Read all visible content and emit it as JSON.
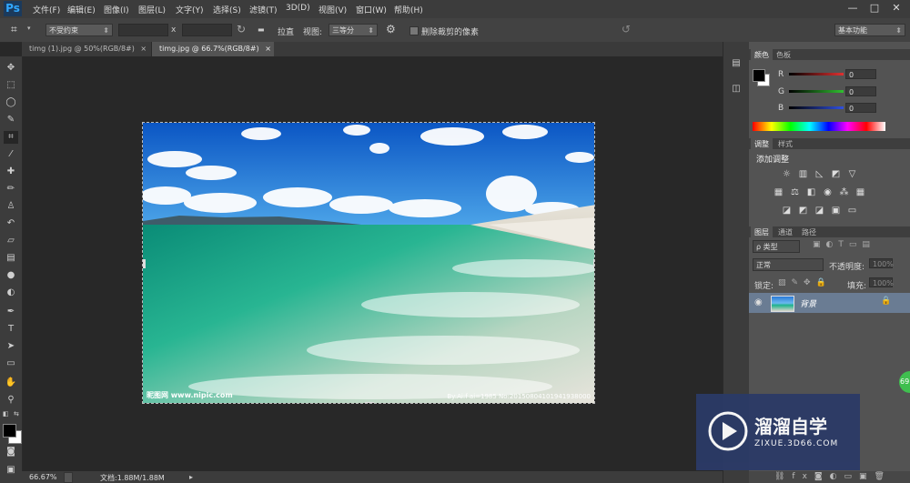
{
  "app": {
    "logo": "Ps"
  },
  "menu": [
    "文件(F)",
    "编辑(E)",
    "图像(I)",
    "图层(L)",
    "文字(Y)",
    "选择(S)",
    "滤镜(T)",
    "3D(D)",
    "视图(V)",
    "窗口(W)",
    "帮助(H)"
  ],
  "window_controls": [
    "—",
    "□",
    "✕"
  ],
  "options": {
    "constraint": "不受约束",
    "multiply": "x",
    "straighten": "拉直",
    "view_label": "视图:",
    "view_value": "三等分",
    "delete_cropped": "删除裁剪的像素",
    "workspace": "基本功能"
  },
  "tabs": [
    {
      "label": "timg (1).jpg @ 50%(RGB/8#)",
      "close": "×"
    },
    {
      "label": "timg.jpg @ 66.7%(RGB/8#)",
      "close": "×"
    }
  ],
  "canvas": {
    "watermark_left": "昵图网 www.nipic.com",
    "watermark_right": "By:Ai:f ai=1985 No:20150804101941938000"
  },
  "status": {
    "zoom": "66.67%",
    "doc": "文档:1.88M/1.88M"
  },
  "color_panel": {
    "tabs": [
      "颜色",
      "色板"
    ],
    "channels": [
      {
        "label": "R",
        "value": "0",
        "color": "#e03030"
      },
      {
        "label": "G",
        "value": "0",
        "color": "#30c030"
      },
      {
        "label": "B",
        "value": "0",
        "color": "#3050e0"
      }
    ]
  },
  "adjust_panel": {
    "tabs": [
      "调整",
      "样式"
    ],
    "title": "添加调整"
  },
  "layers_panel": {
    "tabs": [
      "图层",
      "通道",
      "路径"
    ],
    "filter": "ρ 类型",
    "blend_mode": "正常",
    "opacity_label": "不透明度:",
    "opacity_value": "100%",
    "lock_label": "锁定:",
    "fill_label": "填充:",
    "fill_value": "100%",
    "layer_name": "背景"
  },
  "badge": {
    "value": "69"
  },
  "brand": {
    "title": "溜溜自学",
    "subtitle": "ZIXUE.3D66.COM"
  },
  "colors": {
    "accent": "#31a8ff",
    "sky": "#1e6fd0",
    "sea": "#1fb38c"
  }
}
